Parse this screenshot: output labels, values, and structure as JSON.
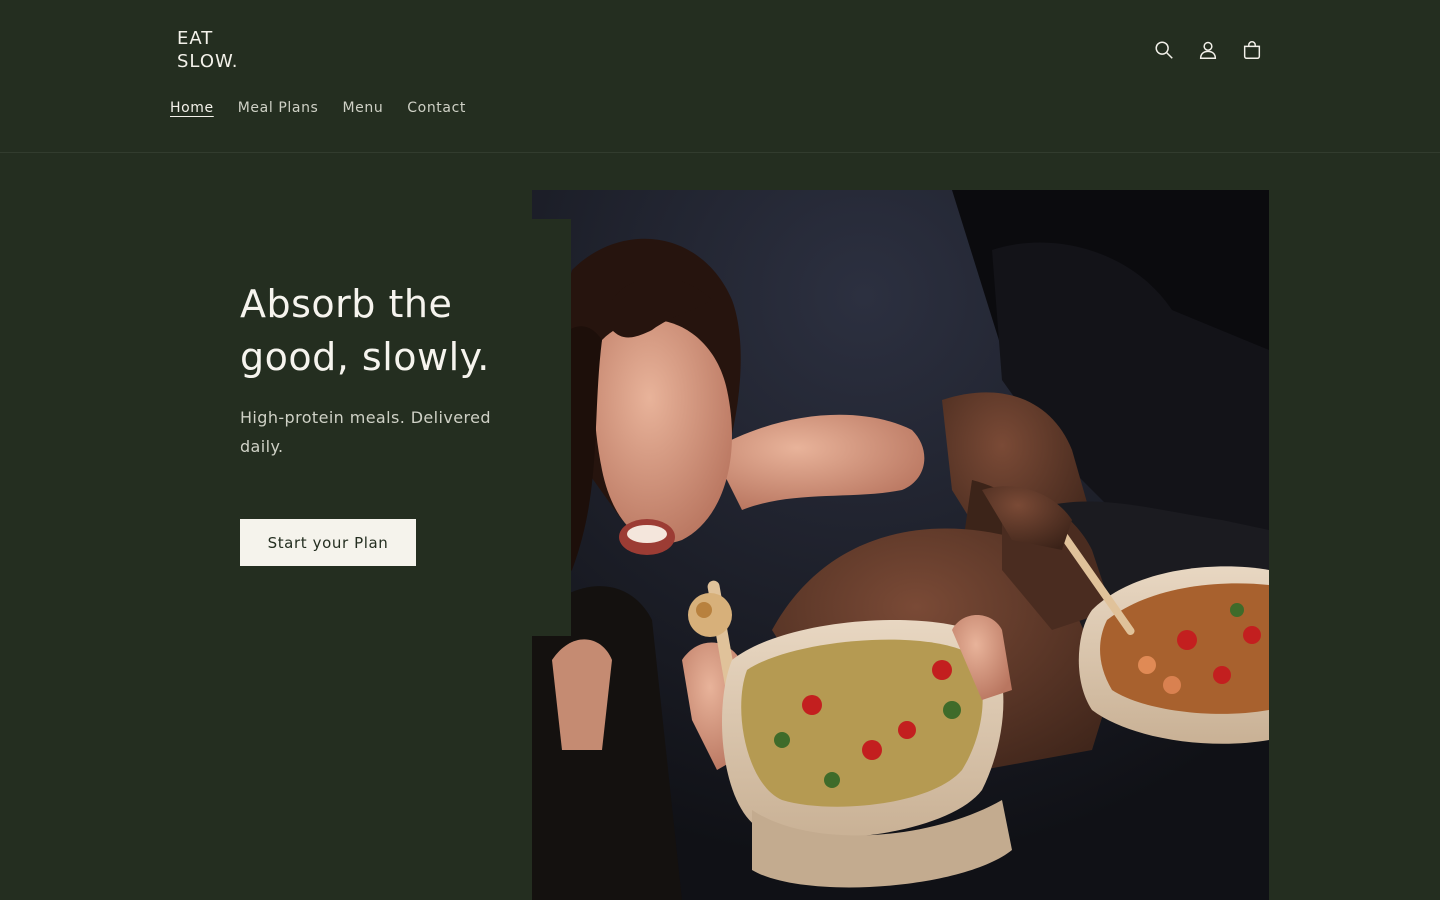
{
  "brand": {
    "line1": "EAT",
    "line2": "SLOW."
  },
  "header_icons": [
    "search-icon",
    "account-icon",
    "cart-icon"
  ],
  "nav": {
    "items": [
      {
        "label": "Home",
        "active": true
      },
      {
        "label": "Meal Plans",
        "active": false
      },
      {
        "label": "Menu",
        "active": false
      },
      {
        "label": "Contact",
        "active": false
      }
    ]
  },
  "hero": {
    "title": "Absorb the good, slowly.",
    "subtitle": "High-protein meals. Delivered daily.",
    "cta_label": "Start your Plan"
  },
  "colors": {
    "background": "#242e20",
    "text": "#f3f1ea",
    "button_bg": "#f5f3ec"
  }
}
